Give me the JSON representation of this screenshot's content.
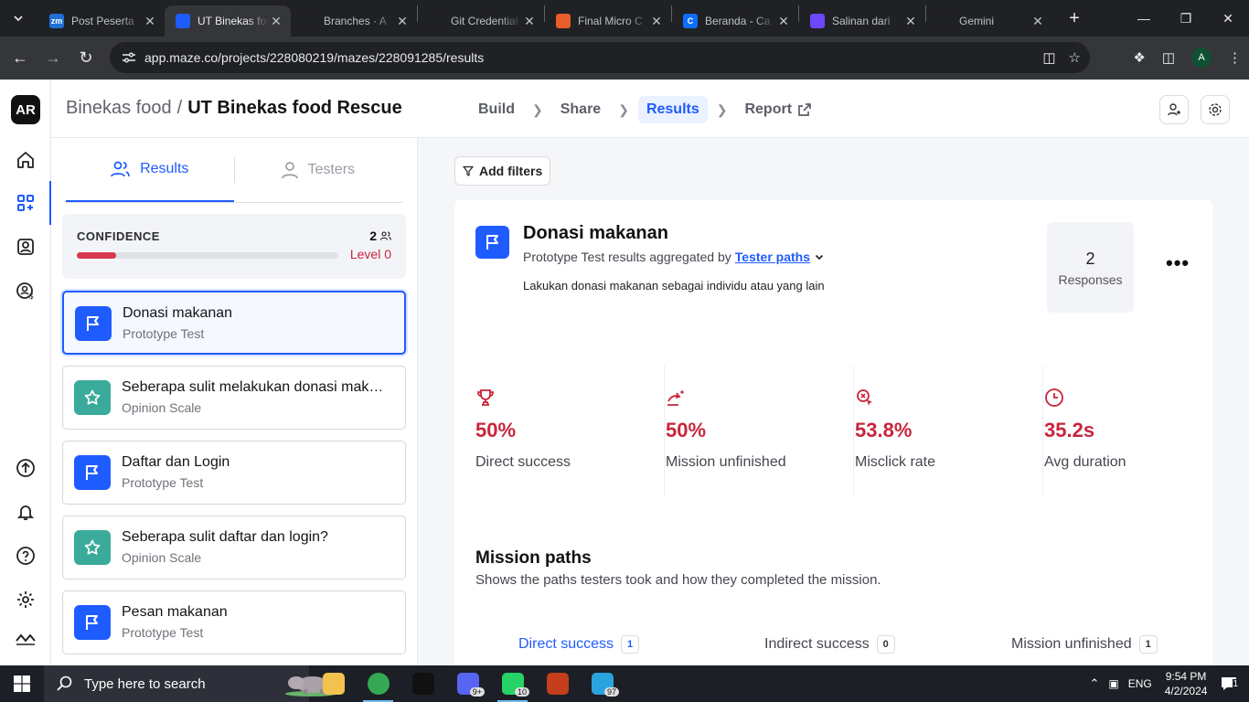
{
  "browser": {
    "tabs": [
      {
        "title": "Post Peserta",
        "fav_color": "#1f6fd6",
        "fav_text": "zm",
        "active": false
      },
      {
        "title": "UT Binekas food",
        "fav_color": "#1f5cff",
        "fav_text": "",
        "active": true
      },
      {
        "title": "Branches · A",
        "fav_color": "#202124",
        "fav_text": "",
        "active": false
      },
      {
        "title": "Git Credential",
        "fav_color": "#202124",
        "fav_text": "",
        "active": false
      },
      {
        "title": "Final Micro C",
        "fav_color": "#e85d2a",
        "fav_text": "",
        "active": false
      },
      {
        "title": "Beranda - Ca",
        "fav_color": "#0d6efd",
        "fav_text": "C",
        "active": false
      },
      {
        "title": "Salinan dari",
        "fav_color": "#6c47ff",
        "fav_text": "",
        "active": false
      },
      {
        "title": "Gemini",
        "fav_color": "#202124",
        "fav_text": "",
        "active": false
      }
    ],
    "url": "app.maze.co/projects/228080219/mazes/228091285/results",
    "profile_initial": "A"
  },
  "app": {
    "logo": "AR",
    "breadcrumb": {
      "project": "Binekas food",
      "separator": "/",
      "maze": "UT Binekas food Rescue"
    },
    "steps": {
      "build": "Build",
      "share": "Share",
      "results": "Results",
      "report": "Report"
    },
    "panel_tabs": {
      "results": "Results",
      "testers": "Testers"
    },
    "confidence": {
      "label": "CONFIDENCE",
      "count": "2",
      "level": "Level 0",
      "progress": 0.15
    },
    "blocks": [
      {
        "title": "Donasi makanan",
        "type": "Prototype Test",
        "kind": "mission",
        "selected": true
      },
      {
        "title": "Seberapa sulit melakukan donasi makanan?",
        "type": "Opinion Scale",
        "kind": "scale",
        "selected": false
      },
      {
        "title": "Daftar dan Login",
        "type": "Prototype Test",
        "kind": "mission",
        "selected": false
      },
      {
        "title": "Seberapa sulit daftar dan login?",
        "type": "Opinion Scale",
        "kind": "scale",
        "selected": false
      },
      {
        "title": "Pesan makanan",
        "type": "Prototype Test",
        "kind": "mission",
        "selected": false
      }
    ],
    "add_filters": "Add filters",
    "result": {
      "title": "Donasi makanan",
      "subtitle_prefix": "Prototype Test results aggregated by",
      "aggregate_link": "Tester paths",
      "description": "Lakukan donasi makanan sebagai individu atau yang lain",
      "responses_count": "2",
      "responses_label": "Responses",
      "more": "•••"
    },
    "metrics": [
      {
        "value": "50%",
        "label": "Direct success",
        "icon": "trophy-icon"
      },
      {
        "value": "50%",
        "label": "Mission unfinished",
        "icon": "unfinished-icon"
      },
      {
        "value": "53.8%",
        "label": "Misclick rate",
        "icon": "misclick-icon"
      },
      {
        "value": "35.2s",
        "label": "Avg duration",
        "icon": "clock-icon"
      }
    ],
    "mission_paths": {
      "title": "Mission paths",
      "subtitle": "Shows the paths testers took and how they completed the mission.",
      "tabs": [
        {
          "label": "Direct success",
          "count": "1"
        },
        {
          "label": "Indirect success",
          "count": "0"
        },
        {
          "label": "Mission unfinished",
          "count": "1"
        }
      ]
    }
  },
  "taskbar": {
    "search_placeholder": "Type here to search",
    "apps": [
      {
        "name": "file-explorer",
        "color": "#f2c14e"
      },
      {
        "name": "chrome",
        "color": "#34a853"
      },
      {
        "name": "figma",
        "color": "#111"
      },
      {
        "name": "discord-like",
        "color": "#5865f2",
        "badge": "9+"
      },
      {
        "name": "whatsapp",
        "color": "#25d366",
        "badge": "10"
      },
      {
        "name": "powerpoint",
        "color": "#c43e1c"
      },
      {
        "name": "telegram",
        "color": "#2aa3df",
        "badge": "97"
      }
    ],
    "lang": "ENG",
    "time": "9:54 PM",
    "date": "4/2/2024",
    "notif": "1"
  }
}
